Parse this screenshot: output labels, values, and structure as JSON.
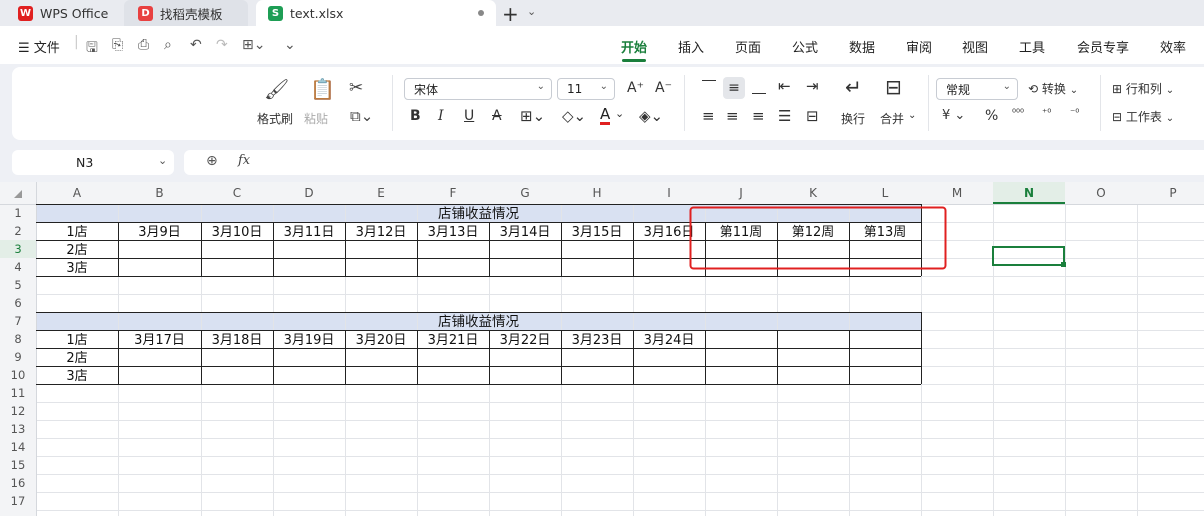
{
  "tabs": [
    {
      "label": "WPS Office",
      "icon": "wps-logo-icon"
    },
    {
      "label": "找稻壳模板",
      "icon": "docer-icon"
    },
    {
      "label": "text.xlsx",
      "icon": "spreadsheet-icon"
    }
  ],
  "menu": {
    "file_label": "文件",
    "items": [
      "开始",
      "插入",
      "页面",
      "公式",
      "数据",
      "审阅",
      "视图",
      "工具",
      "会员专享",
      "效率"
    ],
    "active": "开始"
  },
  "ribbon": {
    "format_painter": "格式刷",
    "paste": "粘贴",
    "font_name": "宋体",
    "font_size": "11",
    "wrap": "换行",
    "merge": "合并",
    "number_format": "常规",
    "convert": "转换",
    "row_col": "行和列",
    "worksheet": "工作表",
    "currency_symbol": "¥",
    "percent_symbol": "%"
  },
  "formula_bar": {
    "cell_ref": "N3",
    "fx": "fx",
    "value": ""
  },
  "sheet": {
    "columns": [
      "A",
      "B",
      "C",
      "D",
      "E",
      "F",
      "G",
      "H",
      "I",
      "J",
      "K",
      "L",
      "M",
      "N",
      "O",
      "P"
    ],
    "rows": [
      "1",
      "2",
      "3",
      "4",
      "5",
      "6",
      "7",
      "8",
      "9",
      "10",
      "11",
      "12",
      "13",
      "14",
      "15",
      "16",
      "17"
    ],
    "selected_cell": "N3",
    "table1": {
      "title": "店铺收益情况",
      "headers": [
        "1店",
        "3月9日",
        "3月10日",
        "3月11日",
        "3月12日",
        "3月13日",
        "3月14日",
        "3月15日",
        "3月16日",
        "第11周",
        "第12周",
        "第13周"
      ],
      "stores": [
        "2店",
        "3店"
      ]
    },
    "table2": {
      "title": "店铺收益情况",
      "headers": [
        "1店",
        "3月17日",
        "3月18日",
        "3月19日",
        "3月20日",
        "3月21日",
        "3月22日",
        "3月23日",
        "3月24日",
        "",
        "",
        ""
      ],
      "stores": [
        "2店",
        "3店"
      ]
    }
  },
  "colors": {
    "accent": "#1a7f3c",
    "title_fill": "#d9e1f2",
    "highlight_box": "#e02020"
  }
}
